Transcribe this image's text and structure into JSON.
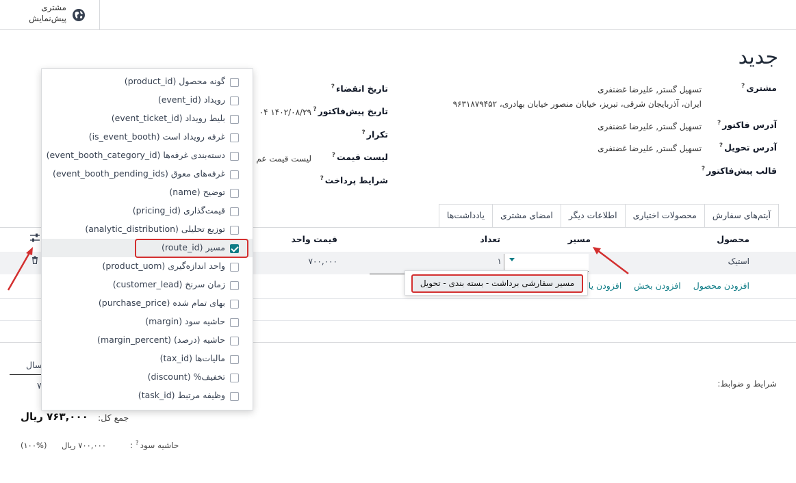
{
  "topbar": {
    "portal_line1": "مشتری",
    "portal_line2": "پیش‌نمایش"
  },
  "form": {
    "title": "جدید",
    "customer_label": "مشتری",
    "customer_name": "تسهیل گستر, علیرضا غضنفری",
    "customer_address": "ایران، آذربایجان شرقی، تبریز، خیابان منصور خیابان بهادری، ۹۶۳۱۸۷۹۴۵۲",
    "invoice_addr_label": "آدرس فاکتور",
    "invoice_addr_value": "تسهیل گستر, علیرضا غضنفری",
    "delivery_addr_label": "آدرس تحویل",
    "delivery_addr_value": "تسهیل گستر, علیرضا غضنفری",
    "quote_template_label": "قالب پیش‌فاکتور",
    "expiration_label": "تاریخ انقضاء",
    "quote_date_label": "تاریخ پیش‌فاکتور",
    "quote_date_value": "۱۴۰۲/۰۸/۲۹ ۰۴",
    "recurrence_label": "تکرار",
    "pricelist_label": "لیست قیمت",
    "pricelist_value": "لیست قیمت عم",
    "payment_terms_label": "شرایط پرداخت",
    "help_mark": "?"
  },
  "tabs": [
    "آیتم‌های سفارش",
    "محصولات اختیاری",
    "اطلاعات دیگر",
    "امضای مشتری",
    "یادداشت‌ها"
  ],
  "table": {
    "headers": {
      "product": "محصول",
      "route": "مسیر",
      "quantity": "تعداد",
      "unit_price": "قیمت واحد"
    },
    "row": {
      "product": "استیک",
      "quantity": "۱",
      "unit_price": "۷۰۰,۰۰۰"
    },
    "add_product": "افزودن محصول",
    "add_section": "افزودن بخش",
    "add_note": "افزودن یاد"
  },
  "route_dropdown": {
    "option": "مسیر سفارشی برداشت - بسته بندی - تحویل"
  },
  "optional_columns": [
    {
      "label": "گونه محصول (product_id)",
      "checked": false
    },
    {
      "label": "رویداد (event_id)",
      "checked": false
    },
    {
      "label": "بلیط رویداد (event_ticket_id)",
      "checked": false
    },
    {
      "label": "غرفه رویداد است (is_event_booth)",
      "checked": false
    },
    {
      "label": "دسته‌بندی غرفه‌ها (event_booth_category_id)",
      "checked": false
    },
    {
      "label": "غرفه‌های معوق (event_booth_pending_ids)",
      "checked": false
    },
    {
      "label": "توضیح (name)",
      "checked": false
    },
    {
      "label": "قیمت‌گذاری (pricing_id)",
      "checked": false
    },
    {
      "label": "توزیع تحلیلی (analytic_distribution)",
      "checked": false
    },
    {
      "label": "مسیر (route_id)",
      "checked": true
    },
    {
      "label": "واحد اندازه‌گیری (product_uom)",
      "checked": false
    },
    {
      "label": "زمان سرنخ (customer_lead)",
      "checked": false
    },
    {
      "label": "بهای تمام شده (purchase_price)",
      "checked": false
    },
    {
      "label": "حاشیه سود (margin)",
      "checked": false
    },
    {
      "label": "حاشیه (درصد) (margin_percent)",
      "checked": false
    },
    {
      "label": "مالیات‌ها (tax_id)",
      "checked": false
    },
    {
      "label": "تخفیف% (discount)",
      "checked": false
    },
    {
      "label": "وظیفه مرتبط (task_id)",
      "checked": false
    }
  ],
  "bottom": {
    "terms_label": "شرایط و ضوابط:",
    "tab_fragment": "سال",
    "tab_value_fragment": "۷",
    "total_label": "جمع کل:",
    "total_value": "۷۶۳,۰۰۰ ریال",
    "margin_label": "حاشیه سود",
    "margin_colon": ":",
    "margin_value": "۷۰۰,۰۰۰ ریال",
    "margin_percent": "(۱۰۰%)"
  },
  "colors": {
    "accent": "#0e7c86",
    "highlight_red": "#d32f2f",
    "row_bg": "#f1f2f4"
  }
}
